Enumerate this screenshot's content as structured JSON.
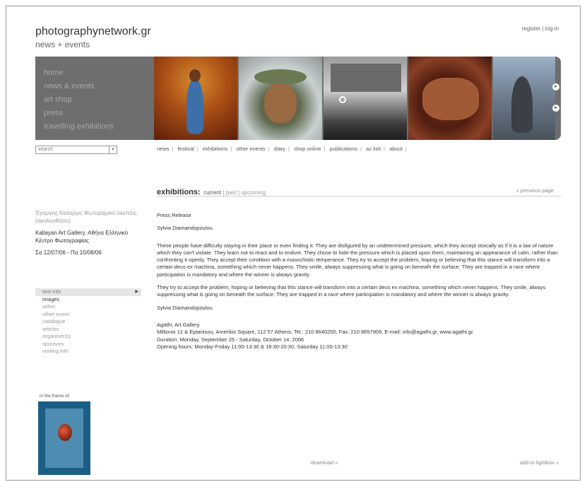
{
  "header": {
    "site_title": "photographynetwork.gr",
    "site_subtitle": "news + events",
    "register": "register",
    "auth_sep": "|",
    "login": "log in"
  },
  "banner": {
    "menu": [
      "home",
      "news & events",
      "art shop",
      "press",
      "travelling exhibitions"
    ]
  },
  "search": {
    "placeholder": "search"
  },
  "topnav": [
    "news",
    "festival",
    "exhibitions",
    "other events",
    "diary",
    "shop online",
    "publications",
    "az listi",
    "about"
  ],
  "section": {
    "title": "exhibitions:",
    "current": "current",
    "past": "past",
    "upcoming": "upcoming",
    "sep": "|",
    "prev": "« previous page"
  },
  "exhibit_info": {
    "greek_title": "Έγαργας Καλαργις Φωτοραμικο σκεπσις",
    "greek_sub": "(ακολουθήσει)",
    "venue": "Kallayan Art Gallery, Αθήνα Ελληνικό Κέντρο Φωτογραφίας",
    "dates": "Σα 12/07/06 - Πα 10/08/06"
  },
  "left_menu": [
    {
      "label": "text info",
      "active": true
    },
    {
      "label": "images",
      "bold": true
    },
    {
      "label": "video"
    },
    {
      "label": "other event"
    },
    {
      "label": "catalogue"
    },
    {
      "label": "articles"
    },
    {
      "label": "organiser(s)"
    },
    {
      "label": "sponsors"
    },
    {
      "label": "visiting info"
    }
  ],
  "frame_label": "in the frame of:",
  "content": {
    "press_release": "Press Release",
    "author_top": "Sylvia Diamandopoulou",
    "para1": "These people have difficulty staying in their place or even finding it. They are disfigured by an undetermined pressure, which they accept stoically as if it is a law of nature which they can't violate. They learn not to react and to endure. They chose to hide the pressure which is placed upon them, maintaining an appearance of calm, rather than confronting it openly. They accept their condition with a masochistic temperance. They try to accept the problem, hoping or believing that this stance will transform into a certain deus ex machina, something which never happens. They smile, always suppressing what is going on beneath the surface. They are trapped in a race where participation is mandatory and where the winner is always gravity.",
    "para2": "They try to accept the problem, hoping or believing that this stance will transform into a certain deus ex machina, something which never happens. They smile, always suppressing what is going on beneath the surface. They are trapped in a race where participation is mandatory and where the winner is always gravity.",
    "author_bottom": "Sylvia Diamandopoulou",
    "gallery": "Agathi, Art Gallery",
    "address": "Millionis 12 & Eptanisou, Amerikis Square, 112 57 Athens, Tel.: 210 8640250, Fax: 210 8657909, E-mail: info@agathi.gr, www.agathi.gr",
    "duration": "Duration: Monday, September 25 - Saturday, October 14, 2006",
    "hours": "Opening hours: Monday-Friday 11:00-13:30 & 18:30-20:30, Saturday 11:00-13:30"
  },
  "footer": {
    "download": "download »",
    "lightbox": "add to lightbox »"
  }
}
